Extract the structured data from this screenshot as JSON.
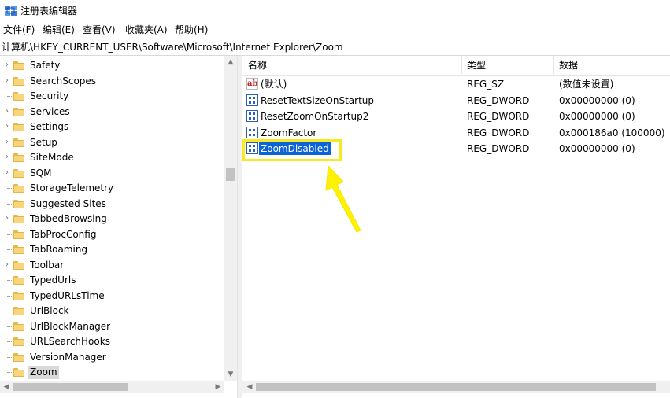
{
  "window": {
    "title": "注册表编辑器"
  },
  "menu": [
    "文件(F)",
    "编辑(E)",
    "查看(V)",
    "收藏夹(A)",
    "帮助(H)"
  ],
  "address": "计算机\\HKEY_CURRENT_USER\\Software\\Microsoft\\Internet Explorer\\Zoom",
  "tree": {
    "items": [
      {
        "label": "Safety",
        "expandable": true
      },
      {
        "label": "SearchScopes",
        "expandable": true
      },
      {
        "label": "Security",
        "expandable": false
      },
      {
        "label": "Services",
        "expandable": true
      },
      {
        "label": "Settings",
        "expandable": true
      },
      {
        "label": "Setup",
        "expandable": true
      },
      {
        "label": "SiteMode",
        "expandable": true
      },
      {
        "label": "SQM",
        "expandable": true
      },
      {
        "label": "StorageTelemetry",
        "expandable": false
      },
      {
        "label": "Suggested Sites",
        "expandable": false
      },
      {
        "label": "TabbedBrowsing",
        "expandable": true
      },
      {
        "label": "TabProcConfig",
        "expandable": false
      },
      {
        "label": "TabRoaming",
        "expandable": false
      },
      {
        "label": "Toolbar",
        "expandable": true
      },
      {
        "label": "TypedUrls",
        "expandable": false
      },
      {
        "label": "TypedURLsTime",
        "expandable": false
      },
      {
        "label": "UrlBlock",
        "expandable": false
      },
      {
        "label": "UrlBlockManager",
        "expandable": false
      },
      {
        "label": "URLSearchHooks",
        "expandable": false
      },
      {
        "label": "VersionManager",
        "expandable": false
      },
      {
        "label": "Zoom",
        "expandable": false,
        "selected": true
      }
    ]
  },
  "list": {
    "headers": {
      "name": "名称",
      "type": "类型",
      "data": "数据"
    },
    "rows": [
      {
        "icon": "string-value-icon",
        "icon_text": "ab",
        "name": "(默认)",
        "type": "REG_SZ",
        "data": "(数值未设置)"
      },
      {
        "icon": "binary-value-icon",
        "name": "ResetTextSizeOnStartup",
        "type": "REG_DWORD",
        "data": "0x00000000 (0)"
      },
      {
        "icon": "binary-value-icon",
        "name": "ResetZoomOnStartup2",
        "type": "REG_DWORD",
        "data": "0x00000000 (0)"
      },
      {
        "icon": "binary-value-icon",
        "name": "ZoomFactor",
        "type": "REG_DWORD",
        "data": "0x000186a0 (100000)"
      },
      {
        "icon": "binary-value-icon",
        "name": "ZoomDisabled",
        "type": "REG_DWORD",
        "data": "0x00000000 (0)",
        "selected": true
      }
    ]
  },
  "colors": {
    "selection": "#0a64d8",
    "highlight": "#f5ea24",
    "arrow": "#fff200"
  }
}
